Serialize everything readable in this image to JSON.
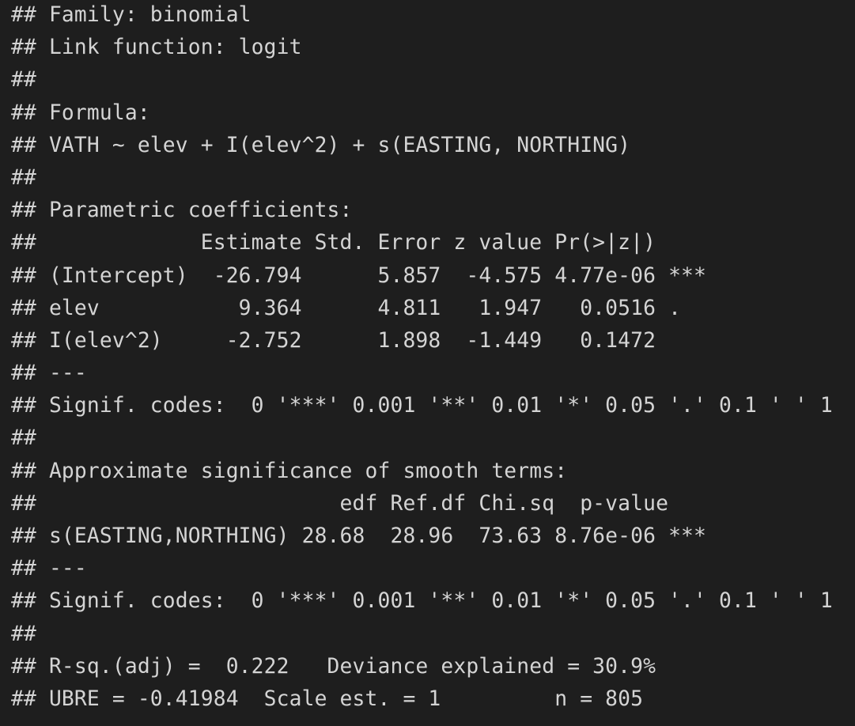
{
  "console": {
    "lines": [
      "## Family: binomial",
      "## Link function: logit",
      "##",
      "## Formula:",
      "## VATH ~ elev + I(elev^2) + s(EASTING, NORTHING)",
      "##",
      "## Parametric coefficients:",
      "##             Estimate Std. Error z value Pr(>|z|)",
      "## (Intercept)  -26.794      5.857  -4.575 4.77e-06 ***",
      "## elev           9.364      4.811   1.947   0.0516 .",
      "## I(elev^2)     -2.752      1.898  -1.449   0.1472",
      "## ---",
      "## Signif. codes:  0 '***' 0.001 '**' 0.01 '*' 0.05 '.' 0.1 ' ' 1",
      "##",
      "## Approximate significance of smooth terms:",
      "##                        edf Ref.df Chi.sq  p-value",
      "## s(EASTING,NORTHING) 28.68  28.96  73.63 8.76e-06 ***",
      "## ---",
      "## Signif. codes:  0 '***' 0.001 '**' 0.01 '*' 0.05 '.' 0.1 ' ' 1",
      "##",
      "## R-sq.(adj) =  0.222   Deviance explained = 30.9%",
      "## UBRE = -0.41984  Scale est. = 1         n = 805"
    ]
  }
}
